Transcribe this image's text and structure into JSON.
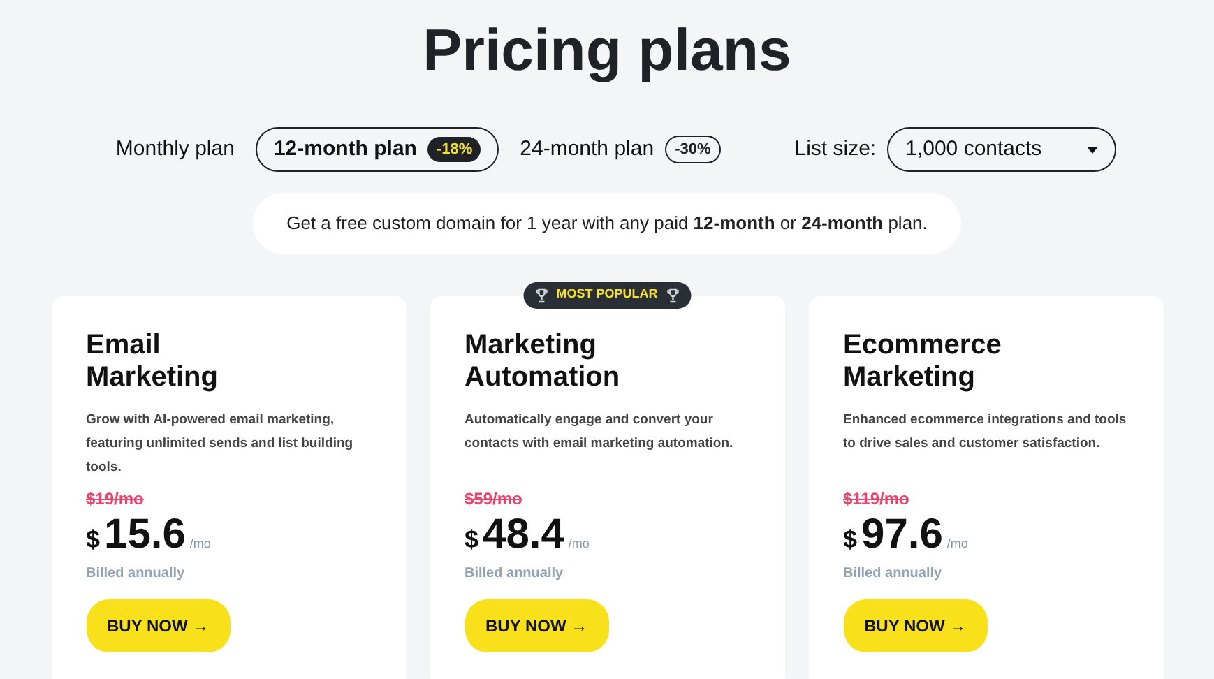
{
  "title": "Pricing plans",
  "plan_tabs": [
    {
      "label": "Monthly plan",
      "selected": false
    },
    {
      "label": "12-month plan",
      "selected": true,
      "discount": "-18%"
    },
    {
      "label": "24-month plan",
      "selected": false,
      "discount": "-30%"
    }
  ],
  "list_size": {
    "label": "List size:",
    "value": "1,000 contacts"
  },
  "promo": "Get a free custom domain for 1 year with any paid **12-month** or **24-month** plan.",
  "plans": [
    {
      "name": "Email Marketing",
      "description": "Grow with AI-powered email marketing, featuring unlimited sends and list building tools.",
      "old_price": "$19/mo",
      "currency": "$",
      "price": "15.6",
      "unit": "/mo",
      "billing": "Billed annually",
      "button": "BUY NOW →"
    },
    {
      "name": "Marketing Automation",
      "badge": "MOST POPULAR",
      "description": "Automatically engage and convert your contacts with email marketing automation.",
      "old_price": "$59/mo",
      "currency": "$",
      "price": "48.4",
      "unit": "/mo",
      "billing": "Billed annually",
      "button": "BUY NOW →"
    },
    {
      "name": "Ecommerce Marketing",
      "description": "Enhanced ecommerce integrations and tools to drive sales and customer satisfaction.",
      "old_price": "$119/mo",
      "currency": "$",
      "price": "97.6",
      "unit": "/mo",
      "billing": "Billed annually",
      "button": "BUY NOW →"
    }
  ]
}
